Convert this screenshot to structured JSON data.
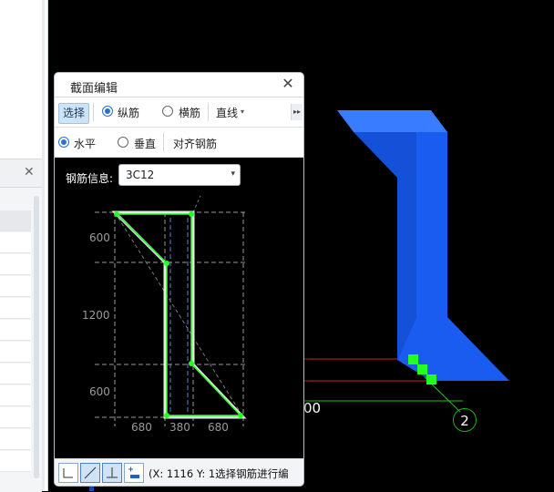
{
  "dialog": {
    "title": "截面编辑",
    "close_icon": "close-icon",
    "toolbar1": {
      "select_label": "选择",
      "longitudinal_label": "纵筋",
      "transverse_label": "横筋",
      "line_mode_label": "直线",
      "line_mode_arrow": "▾",
      "more_glyph": "▸▸"
    },
    "toolbar2": {
      "horizontal_label": "水平",
      "vertical_label": "垂直",
      "align_label": "对齐钢筋"
    },
    "rebar_info": {
      "label": "钢筋信息:",
      "value": "3C12",
      "arrow": "▾"
    },
    "drawing": {
      "dim_left": [
        "600",
        "1200",
        "600"
      ],
      "dim_bottom": [
        "680",
        "380",
        "680"
      ]
    },
    "status": {
      "coords": "(X: 1116 Y: 1选择钢筋进行编"
    }
  },
  "scene": {
    "partial_number": "00",
    "label_number": "2"
  },
  "colors": {
    "beam": "#1a5cf0",
    "beam_dark": "#0b3ea8",
    "beam_light": "#3a7cff",
    "grid_green": "#21c021",
    "grid_red": "#d42020",
    "rebar_green": "#23ff1f",
    "selected_bg": "#cfe3f6"
  }
}
